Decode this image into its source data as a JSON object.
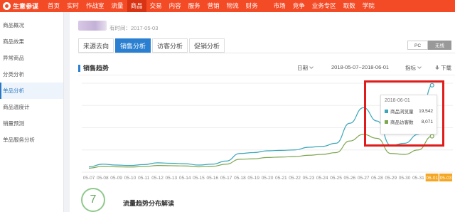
{
  "app": {
    "name": "生意参谋",
    "logo_icon": "sycm-logo-icon"
  },
  "nav": {
    "items": [
      "首页",
      "实时",
      "作战室",
      "流量",
      "商品",
      "交易",
      "内容",
      "服务",
      "营销",
      "物流",
      "财务",
      "市场",
      "竞争",
      "业务专区",
      "取数",
      "学院"
    ],
    "active": "商品"
  },
  "sidebar": {
    "items": [
      "商品概况",
      "商品效果",
      "异常商品",
      "分类分析",
      "单品分析",
      "商品温度计",
      "销量预测",
      "单品服务分析"
    ],
    "active": "单品分析"
  },
  "product": {
    "time_text": "有时间：2017-05-03"
  },
  "tabs": {
    "items": [
      "来源去向",
      "销售分析",
      "访客分析",
      "促销分析"
    ],
    "active": "销售分析"
  },
  "device": {
    "pc": "PC",
    "wireless": "无线",
    "active": "无线"
  },
  "section": {
    "title": "销售趋势"
  },
  "controls": {
    "date_label": "日期",
    "range": "2018-05-07~2018-06-01",
    "metric_label": "指标",
    "download_label": "下载"
  },
  "colors": {
    "accent": "#2a7fd0",
    "topbar": "#f44b27",
    "views_line": "#3aa6b8",
    "visitors_line": "#7da650",
    "highlight_box": "#e01b1b"
  },
  "tooltip": {
    "date": "2018-06-01",
    "rows": [
      {
        "label": "商品浏览量",
        "value": "19,542",
        "color": "#3aa6b8"
      },
      {
        "label": "商品访客数",
        "value": "8,071",
        "color": "#7da650"
      }
    ]
  },
  "chart_data": {
    "type": "line",
    "categories": [
      "05-07",
      "05-08",
      "05-09",
      "05-10",
      "05-11",
      "05-12",
      "05-13",
      "05-14",
      "05-15",
      "05-16",
      "05-17",
      "05-18",
      "05-19",
      "05-20",
      "05-21",
      "05-22",
      "05-23",
      "05-24",
      "05-25",
      "05-26",
      "05-27",
      "05-28",
      "05-29",
      "05-30",
      "05-31",
      "06-01",
      "05-03"
    ],
    "selected_category": "06-01",
    "series": [
      {
        "name": "商品浏览量",
        "values": [
          1200,
          1800,
          1600,
          1500,
          1700,
          2100,
          2000,
          1900,
          1600,
          1800,
          2500,
          4200,
          4400,
          4800,
          4900,
          5000,
          5600,
          5800,
          6500,
          11000,
          14500,
          11500,
          6000,
          6500,
          8500,
          19542,
          null
        ]
      },
      {
        "name": "商品访客数",
        "values": [
          900,
          1300,
          1200,
          1150,
          1250,
          1500,
          1450,
          1400,
          1200,
          1300,
          1800,
          2900,
          3000,
          3300,
          3400,
          3500,
          3800,
          4000,
          4400,
          7000,
          8500,
          7600,
          4200,
          4000,
          5000,
          8071,
          null
        ]
      }
    ],
    "grid": true
  },
  "interpretation": {
    "title": "流量趋势分布解读",
    "badge": "7"
  }
}
